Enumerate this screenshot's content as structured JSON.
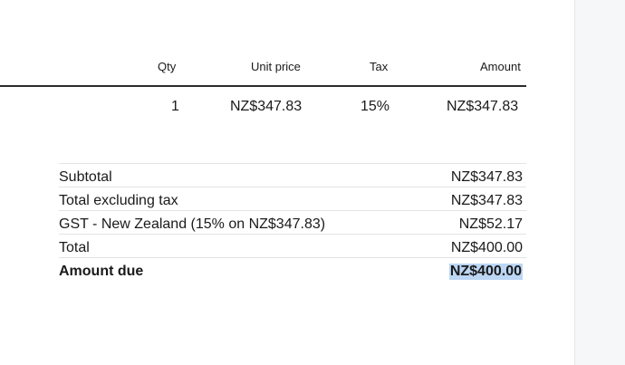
{
  "line_items": {
    "headers": {
      "qty": "Qty",
      "unit_price": "Unit price",
      "tax": "Tax",
      "amount": "Amount"
    },
    "rows": [
      {
        "qty": "1",
        "unit_price": "NZ$347.83",
        "tax": "15%",
        "amount": "NZ$347.83"
      }
    ]
  },
  "summary": [
    {
      "label": "Subtotal",
      "value": "NZ$347.83"
    },
    {
      "label": "Total excluding tax",
      "value": "NZ$347.83"
    },
    {
      "label": "GST - New Zealand (15% on NZ$347.83)",
      "value": "NZ$52.17"
    },
    {
      "label": "Total",
      "value": "NZ$400.00"
    },
    {
      "label": "Amount due",
      "value": "NZ$400.00",
      "emphasis": "bold",
      "selected": true
    }
  ],
  "colors": {
    "selection_highlight": "#bcd6f4",
    "header_rule": "#2b2b2b",
    "row_divider": "#e3e3e3",
    "side_gutter": "#f6f7f8"
  }
}
